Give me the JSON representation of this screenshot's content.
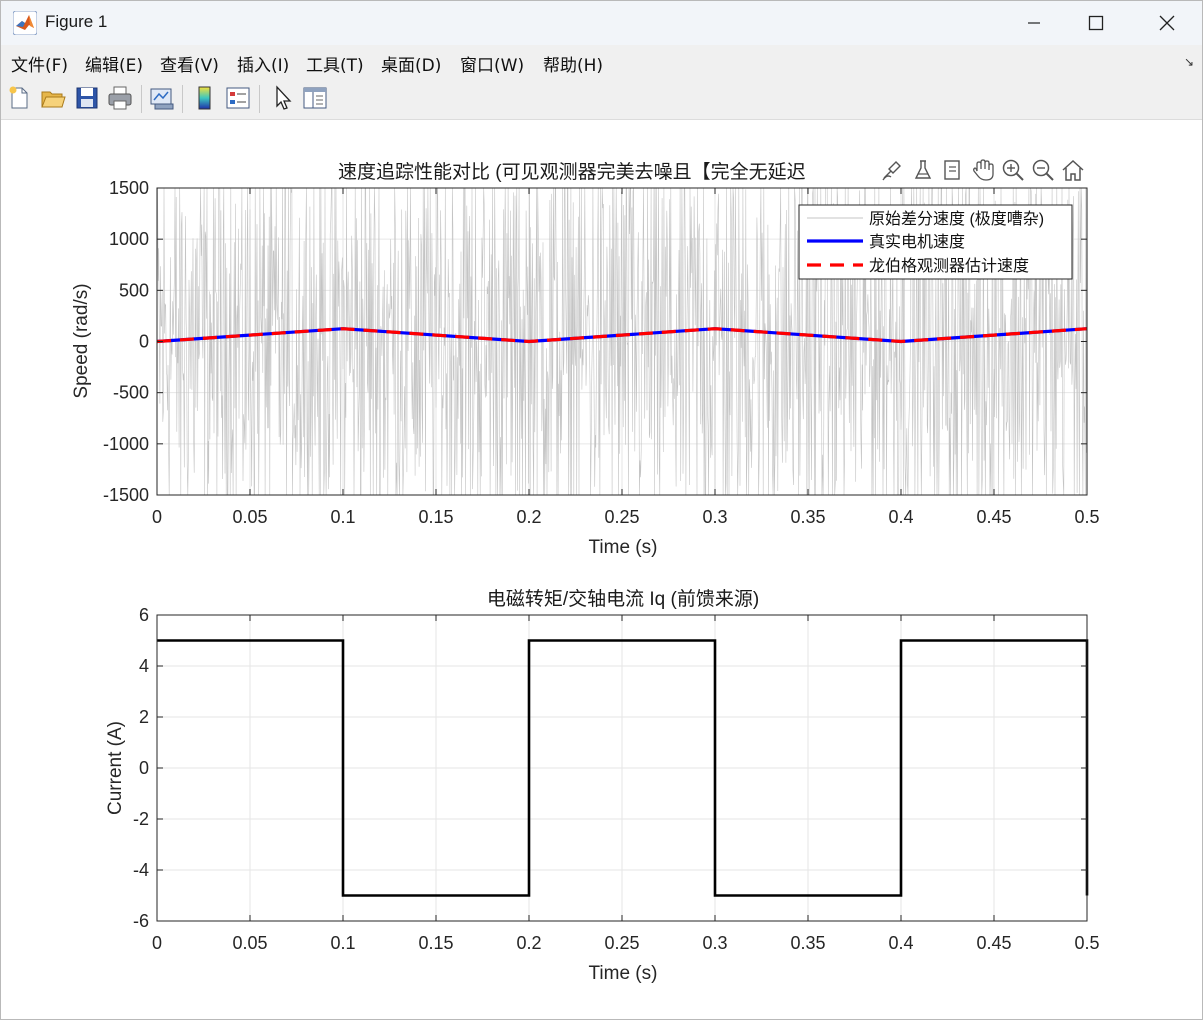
{
  "window": {
    "title": "Figure 1",
    "controls": [
      "minimize-icon",
      "maximize-icon",
      "close-icon"
    ]
  },
  "menu": {
    "items": [
      "文件(F)",
      "编辑(E)",
      "查看(V)",
      "插入(I)",
      "工具(T)",
      "桌面(D)",
      "窗口(W)",
      "帮助(H)"
    ]
  },
  "toolbar": {
    "buttons": [
      "new-figure-icon",
      "open-file-icon",
      "save-icon",
      "print-icon",
      "link-plot-icon",
      "colorbar-icon",
      "legend-icon",
      "pointer-icon",
      "property-inspector-icon"
    ]
  },
  "axes_toolbar": [
    "brush-icon",
    "data-tips-icon",
    "export-icon",
    "pan-hand-icon",
    "zoom-in-icon",
    "zoom-out-icon",
    "home-icon"
  ],
  "colors": {
    "noisy": "#c4c4c4",
    "true_speed": "#0000ff",
    "estimate": "#ff0000",
    "current": "#000000",
    "grid": "#e6e6e6"
  },
  "chart_data": [
    {
      "type": "line",
      "title": "速度追踪性能对比 (可见观测器完美去噪且【完全无延迟",
      "xlabel": "Time (s)",
      "ylabel": "Speed (rad/s)",
      "xlim": [
        0,
        0.5
      ],
      "ylim": [
        -1500,
        1500
      ],
      "xticks": [
        0,
        0.05,
        0.1,
        0.15,
        0.2,
        0.25,
        0.3,
        0.35,
        0.4,
        0.45,
        0.5
      ],
      "yticks": [
        -1500,
        -1000,
        -500,
        0,
        500,
        1000,
        1500
      ],
      "xtick_labels": [
        "0",
        "0.05",
        "0.1",
        "0.15",
        "0.2",
        "0.25",
        "0.3",
        "0.35",
        "0.4",
        "0.45",
        "0.5"
      ],
      "ytick_labels": [
        "-1500",
        "-1000",
        "-500",
        "0",
        "500",
        "1000",
        "1500"
      ],
      "grid": true,
      "legend_position": "top-right",
      "series": [
        {
          "name": "原始差分速度 (极度嘈杂)",
          "style": "noise",
          "amplitude": 1500,
          "color": "#c4c4c4"
        },
        {
          "name": "真实电机速度",
          "style": "solid",
          "color": "#0000ff",
          "x": [
            0,
            0.1,
            0.2,
            0.3,
            0.4,
            0.5
          ],
          "y": [
            0,
            125,
            0,
            125,
            0,
            125
          ]
        },
        {
          "name": "龙伯格观测器估计速度",
          "style": "dashed",
          "color": "#ff0000",
          "x": [
            0,
            0.1,
            0.2,
            0.3,
            0.4,
            0.5
          ],
          "y": [
            0,
            125,
            0,
            125,
            0,
            125
          ]
        }
      ]
    },
    {
      "type": "line",
      "title": "电磁转矩/交轴电流 Iq (前馈来源)",
      "xlabel": "Time (s)",
      "ylabel": "Current (A)",
      "xlim": [
        0,
        0.5
      ],
      "ylim": [
        -6,
        6
      ],
      "xticks": [
        0,
        0.05,
        0.1,
        0.15,
        0.2,
        0.25,
        0.3,
        0.35,
        0.4,
        0.45,
        0.5
      ],
      "yticks": [
        -6,
        -4,
        -2,
        0,
        2,
        4,
        6
      ],
      "xtick_labels": [
        "0",
        "0.05",
        "0.1",
        "0.15",
        "0.2",
        "0.25",
        "0.3",
        "0.35",
        "0.4",
        "0.45",
        "0.5"
      ],
      "ytick_labels": [
        "-6",
        "-4",
        "-2",
        "0",
        "2",
        "4",
        "6"
      ],
      "grid": true,
      "series": [
        {
          "style": "solid",
          "color": "#000000",
          "x": [
            0,
            0.1,
            0.1,
            0.2,
            0.2,
            0.3,
            0.3,
            0.4,
            0.4,
            0.5,
            0.5
          ],
          "y": [
            5,
            5,
            -5,
            -5,
            5,
            5,
            -5,
            -5,
            5,
            5,
            -5
          ]
        }
      ]
    }
  ]
}
